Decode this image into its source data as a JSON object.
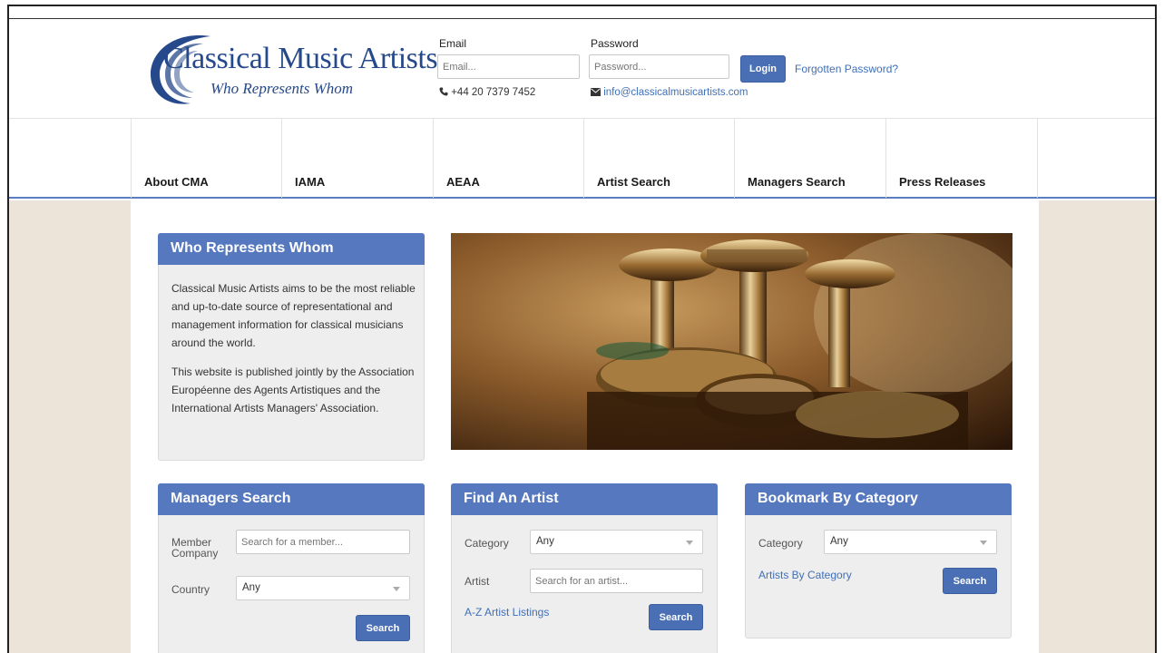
{
  "logo": {
    "brand": "Classical Music Artists",
    "tagline": "Who Represents Whom"
  },
  "login": {
    "email_label": "Email",
    "email_placeholder": "Email...",
    "password_label": "Password",
    "password_placeholder": "Password...",
    "login_button": "Login",
    "forgot_link": "Forgotten Password?",
    "phone": "+44 20 7379 7452",
    "email_contact": "info@classicalmusicartists.com"
  },
  "nav": {
    "items": [
      {
        "label": "About CMA"
      },
      {
        "label": "IAMA"
      },
      {
        "label": "AEAA"
      },
      {
        "label": "Artist Search"
      },
      {
        "label": "Managers Search"
      },
      {
        "label": "Press Releases"
      }
    ]
  },
  "intro": {
    "title": "Who Represents Whom",
    "para1": "Classical Music Artists aims to be the most reliable and up-to-date source of representational and management information for classical musicians around the world.",
    "para2": "This website is published jointly by the Association Européenne des Agents Artistiques and the International Artists Managers' Association."
  },
  "managers": {
    "title": "Managers Search",
    "member_label": "Member Company",
    "member_placeholder": "Search for a member...",
    "country_label": "Country",
    "country_value": "Any",
    "search_button": "Search"
  },
  "find_artist": {
    "title": "Find An Artist",
    "category_label": "Category",
    "category_value": "Any",
    "artist_label": "Artist",
    "artist_placeholder": "Search for an artist...",
    "az_link": "A-Z Artist Listings",
    "search_button": "Search"
  },
  "bookmark": {
    "title": "Bookmark By Category",
    "category_label": "Category",
    "category_value": "Any",
    "by_category_link": "Artists By Category",
    "search_button": "Search"
  },
  "colors": {
    "accent": "#5678bf",
    "link": "#3f6fb8",
    "page_bg": "#ece4d9",
    "brand": "#25498a"
  },
  "icons": {
    "phone": "phone-icon",
    "mail": "envelope-icon",
    "caret": "chevron-down-icon"
  }
}
